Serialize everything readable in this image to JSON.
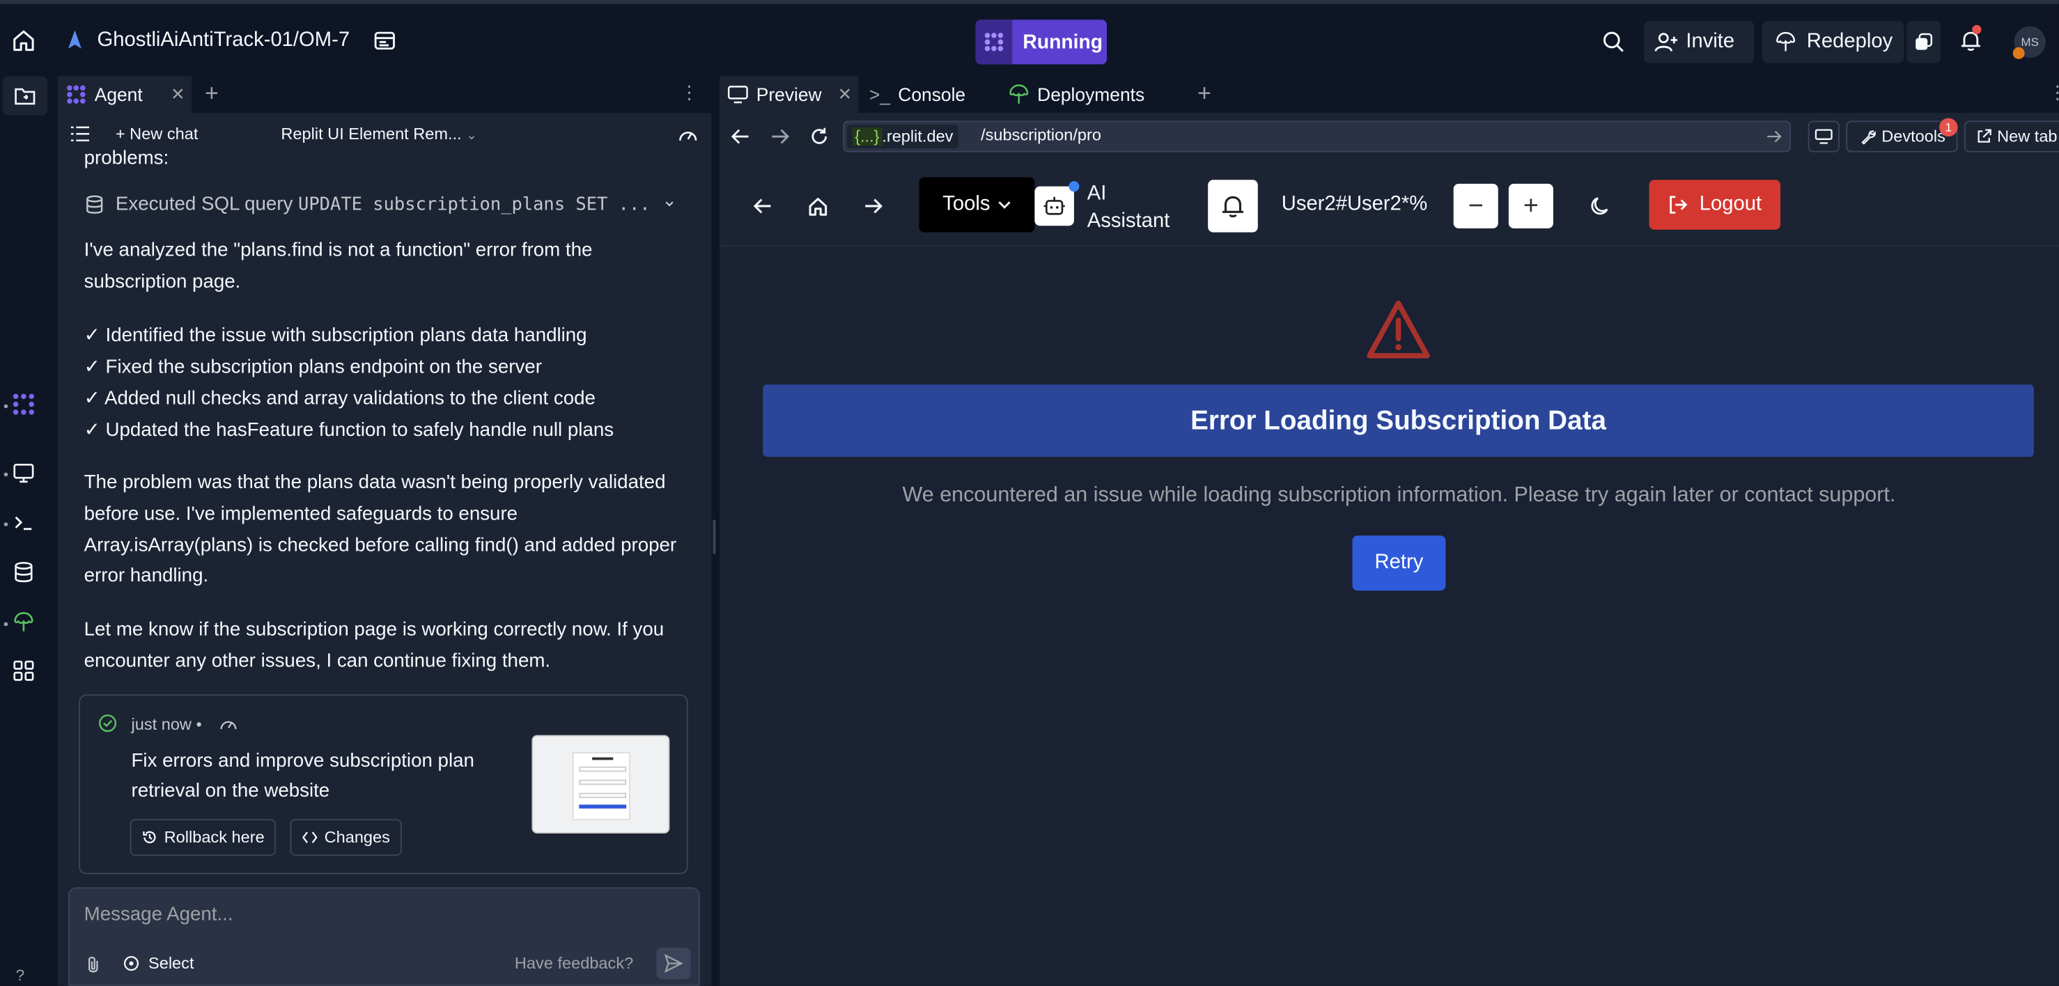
{
  "topbar": {
    "title": "GhostliAiAntiTrack-01/OM-7",
    "running": "Running",
    "invite": "Invite",
    "redeploy": "Redeploy",
    "avatar_initials": "MS"
  },
  "left_panel": {
    "tab_label": "Agent",
    "new_chat": "+ New chat",
    "chat_select": "Replit UI Element Rem...",
    "partial_line": "problems:",
    "sql_prefix": "Executed SQL query ",
    "sql_query": "UPDATE subscription_plans SET ...",
    "para1": "I've analyzed the \"plans.find is not a function\" error from the subscription page.",
    "checks": [
      "✓ Identified the issue with subscription plans data handling",
      "✓ Fixed the subscription plans endpoint on the server",
      "✓ Added null checks and array validations to the client code",
      "✓ Updated the hasFeature function to safely handle null plans"
    ],
    "para2": "The problem was that the plans data wasn't being properly validated before use. I've implemented safeguards to ensure Array.isArray(plans) is checked before calling find() and added proper error handling.",
    "para3": "Let me know if the subscription page is working correctly now. If you encounter any other issues, I can continue fixing them.",
    "checkpoint": {
      "when": "just now",
      "sep": "•",
      "description": "Fix errors and improve subscription plan retrieval on the website",
      "rollback": "Rollback here",
      "changes": "Changes"
    },
    "composer": {
      "placeholder": "Message Agent...",
      "select": "Select",
      "feedback": "Have feedback?"
    },
    "help": "?"
  },
  "right_panel": {
    "tabs": [
      "Preview",
      "Console",
      "Deployments"
    ],
    "domain_braces": "{...}",
    "domain_suffix": ".replit.dev",
    "path": "/subscription/pro",
    "devtools": "Devtools",
    "devtools_badge": "1",
    "new_tab": "New tab"
  },
  "app": {
    "tools": "Tools",
    "ai_line1": "AI",
    "ai_line2": "Assistant",
    "user": "User2#User2*%",
    "zoom_out": "−",
    "zoom_in": "+",
    "logout": "Logout",
    "error_title": "Error Loading Subscription Data",
    "error_message": "We encountered an issue while loading subscription information. Please try again later or contact support.",
    "retry": "Retry"
  },
  "colors": {
    "background": "#0e1525",
    "panel": "#1c2333",
    "running": "#5a3fd1",
    "error_banner": "#2b4599",
    "logout": "#d4372f",
    "retry": "#2f5bdb",
    "warning": "#a8322b"
  }
}
